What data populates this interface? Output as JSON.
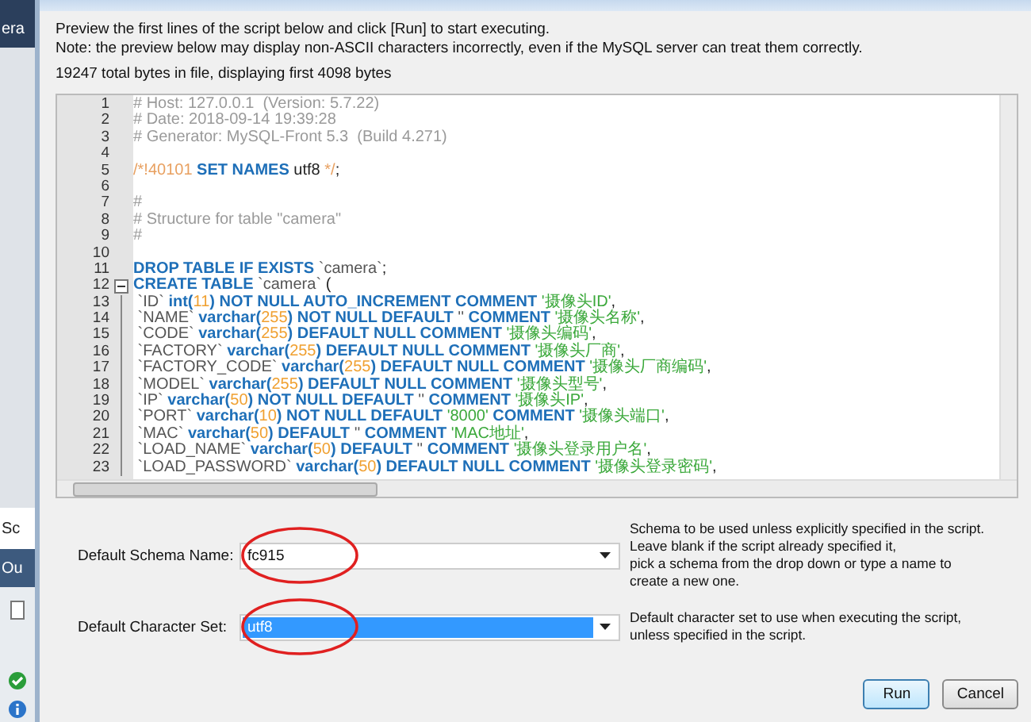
{
  "background_app": {
    "texts": [
      "era",
      "Sc",
      "Ou"
    ]
  },
  "dialog": {
    "intro": [
      "Preview the first lines of the script below and click [Run] to start executing.",
      "Note: the preview below may display non-ASCII characters incorrectly, even if the MySQL server can treat them correctly."
    ],
    "file_info": "19247 total bytes in file, displaying first 4098 bytes",
    "editor": {
      "lines": [
        {
          "number": "1",
          "fold_start": false,
          "in_block": false,
          "segments": [
            {
              "kind": "comment",
              "text": "# Host: 127.0.0.1  (Version: 5.7.22)"
            }
          ]
        },
        {
          "number": "2",
          "fold_start": false,
          "in_block": false,
          "segments": [
            {
              "kind": "comment",
              "text": "# Date: 2018-09-14 19:39:28"
            }
          ]
        },
        {
          "number": "3",
          "fold_start": false,
          "in_block": false,
          "segments": [
            {
              "kind": "comment",
              "text": "# Generator: MySQL-Front 5.3  (Build 4.271)"
            }
          ]
        },
        {
          "number": "4",
          "fold_start": false,
          "in_block": false
        },
        {
          "number": "5",
          "fold_start": false,
          "in_block": false,
          "segments": [
            {
              "kind": "directive",
              "text": "/*!40101 "
            },
            {
              "kind": "keyword",
              "text": "SET NAMES"
            },
            {
              "kind": "plain",
              "text": " utf8 "
            },
            {
              "kind": "directive",
              "text": "*/"
            },
            {
              "kind": "plain",
              "text": ";"
            }
          ]
        },
        {
          "number": "6",
          "fold_start": false,
          "in_block": false
        },
        {
          "number": "7",
          "fold_start": false,
          "in_block": false,
          "segments": [
            {
              "kind": "comment",
              "text": "#"
            }
          ]
        },
        {
          "number": "8",
          "fold_start": false,
          "in_block": false,
          "segments": [
            {
              "kind": "comment",
              "text": "# Structure for table \"camera\""
            }
          ]
        },
        {
          "number": "9",
          "fold_start": false,
          "in_block": false,
          "segments": [
            {
              "kind": "comment",
              "text": "#"
            }
          ]
        },
        {
          "number": "10",
          "fold_start": false,
          "in_block": false
        },
        {
          "number": "11",
          "fold_start": false,
          "in_block": false,
          "segments": [
            {
              "kind": "keyword",
              "text": "DROP TABLE IF EXISTS"
            },
            {
              "kind": "ident",
              "text": " `camera`"
            },
            {
              "kind": "plain",
              "text": ";"
            }
          ]
        },
        {
          "number": "12",
          "fold_start": true,
          "in_block": false,
          "segments": [
            {
              "kind": "keyword",
              "text": "CREATE TABLE"
            },
            {
              "kind": "ident",
              "text": " `camera`"
            },
            {
              "kind": "plain",
              "text": " ("
            }
          ]
        },
        {
          "number": "13",
          "fold_start": false,
          "in_block": true,
          "segments": [
            {
              "kind": "ident",
              "text": " `ID` "
            },
            {
              "kind": "keyword",
              "text": "int("
            },
            {
              "kind": "number",
              "text": "11"
            },
            {
              "kind": "keyword",
              "text": ") NOT NULL AUTO_INCREMENT COMMENT "
            },
            {
              "kind": "string",
              "text": "'摄像头ID'"
            },
            {
              "kind": "plain",
              "text": ","
            }
          ]
        },
        {
          "number": "14",
          "fold_start": false,
          "in_block": true,
          "segments": [
            {
              "kind": "ident",
              "text": " `NAME` "
            },
            {
              "kind": "keyword",
              "text": "varchar("
            },
            {
              "kind": "number",
              "text": "255"
            },
            {
              "kind": "keyword",
              "text": ") NOT NULL DEFAULT "
            },
            {
              "kind": "ident",
              "text": "''"
            },
            {
              "kind": "keyword",
              "text": " COMMENT "
            },
            {
              "kind": "string",
              "text": "'摄像头名称'"
            },
            {
              "kind": "plain",
              "text": ","
            }
          ]
        },
        {
          "number": "15",
          "fold_start": false,
          "in_block": true,
          "segments": [
            {
              "kind": "ident",
              "text": " `CODE` "
            },
            {
              "kind": "keyword",
              "text": "varchar("
            },
            {
              "kind": "number",
              "text": "255"
            },
            {
              "kind": "keyword",
              "text": ") DEFAULT NULL COMMENT "
            },
            {
              "kind": "string",
              "text": "'摄像头编码'"
            },
            {
              "kind": "plain",
              "text": ","
            }
          ]
        },
        {
          "number": "16",
          "fold_start": false,
          "in_block": true,
          "segments": [
            {
              "kind": "ident",
              "text": " `FACTORY` "
            },
            {
              "kind": "keyword",
              "text": "varchar("
            },
            {
              "kind": "number",
              "text": "255"
            },
            {
              "kind": "keyword",
              "text": ") DEFAULT NULL COMMENT "
            },
            {
              "kind": "string",
              "text": "'摄像头厂商'"
            },
            {
              "kind": "plain",
              "text": ","
            }
          ]
        },
        {
          "number": "17",
          "fold_start": false,
          "in_block": true,
          "segments": [
            {
              "kind": "ident",
              "text": " `FACTORY_CODE` "
            },
            {
              "kind": "keyword",
              "text": "varchar("
            },
            {
              "kind": "number",
              "text": "255"
            },
            {
              "kind": "keyword",
              "text": ") DEFAULT NULL COMMENT "
            },
            {
              "kind": "string",
              "text": "'摄像头厂商编码'"
            },
            {
              "kind": "plain",
              "text": ","
            }
          ]
        },
        {
          "number": "18",
          "fold_start": false,
          "in_block": true,
          "segments": [
            {
              "kind": "ident",
              "text": " `MODEL` "
            },
            {
              "kind": "keyword",
              "text": "varchar("
            },
            {
              "kind": "number",
              "text": "255"
            },
            {
              "kind": "keyword",
              "text": ") DEFAULT NULL COMMENT "
            },
            {
              "kind": "string",
              "text": "'摄像头型号'"
            },
            {
              "kind": "plain",
              "text": ","
            }
          ]
        },
        {
          "number": "19",
          "fold_start": false,
          "in_block": true,
          "segments": [
            {
              "kind": "ident",
              "text": " `IP` "
            },
            {
              "kind": "keyword",
              "text": "varchar("
            },
            {
              "kind": "number",
              "text": "50"
            },
            {
              "kind": "keyword",
              "text": ") NOT NULL DEFAULT "
            },
            {
              "kind": "ident",
              "text": "''"
            },
            {
              "kind": "keyword",
              "text": " COMMENT "
            },
            {
              "kind": "string",
              "text": "'摄像头IP'"
            },
            {
              "kind": "plain",
              "text": ","
            }
          ]
        },
        {
          "number": "20",
          "fold_start": false,
          "in_block": true,
          "segments": [
            {
              "kind": "ident",
              "text": " `PORT` "
            },
            {
              "kind": "keyword",
              "text": "varchar("
            },
            {
              "kind": "number",
              "text": "10"
            },
            {
              "kind": "keyword",
              "text": ") NOT NULL DEFAULT "
            },
            {
              "kind": "string",
              "text": "'8000'"
            },
            {
              "kind": "keyword",
              "text": " COMMENT "
            },
            {
              "kind": "string",
              "text": "'摄像头端口'"
            },
            {
              "kind": "plain",
              "text": ","
            }
          ]
        },
        {
          "number": "21",
          "fold_start": false,
          "in_block": true,
          "segments": [
            {
              "kind": "ident",
              "text": " `MAC` "
            },
            {
              "kind": "keyword",
              "text": "varchar("
            },
            {
              "kind": "number",
              "text": "50"
            },
            {
              "kind": "keyword",
              "text": ") DEFAULT "
            },
            {
              "kind": "ident",
              "text": "''"
            },
            {
              "kind": "keyword",
              "text": " COMMENT "
            },
            {
              "kind": "string",
              "text": "'MAC地址'"
            },
            {
              "kind": "plain",
              "text": ","
            }
          ]
        },
        {
          "number": "22",
          "fold_start": false,
          "in_block": true,
          "segments": [
            {
              "kind": "ident",
              "text": " `LOAD_NAME` "
            },
            {
              "kind": "keyword",
              "text": "varchar("
            },
            {
              "kind": "number",
              "text": "50"
            },
            {
              "kind": "keyword",
              "text": ") DEFAULT "
            },
            {
              "kind": "ident",
              "text": "''"
            },
            {
              "kind": "keyword",
              "text": " COMMENT "
            },
            {
              "kind": "string",
              "text": "'摄像头登录用户名'"
            },
            {
              "kind": "plain",
              "text": ","
            }
          ]
        },
        {
          "number": "23",
          "fold_start": false,
          "in_block": true,
          "segments": [
            {
              "kind": "ident",
              "text": " `LOAD_PASSWORD` "
            },
            {
              "kind": "keyword",
              "text": "varchar("
            },
            {
              "kind": "number",
              "text": "50"
            },
            {
              "kind": "keyword",
              "text": ") DEFAULT NULL COMMENT "
            },
            {
              "kind": "string",
              "text": "'摄像头登录密码'"
            },
            {
              "kind": "plain",
              "text": ","
            }
          ]
        }
      ]
    },
    "fields": [
      {
        "label": "Default Schema Name:",
        "value": "fc915",
        "selected": false,
        "circled": true,
        "help": [
          "Schema to be used unless explicitly specified in the script.",
          "Leave blank if the script already specified it,",
          "pick a schema from the drop down or type a name to",
          "create a new one."
        ]
      },
      {
        "label": "Default Character Set:",
        "value": "utf8",
        "selected": true,
        "circled": true,
        "help": [
          "Default character set to use when executing the script,",
          "unless specified in the script."
        ]
      }
    ],
    "buttons": [
      {
        "label": "Run",
        "default": true
      },
      {
        "label": "Cancel",
        "default": false
      }
    ]
  }
}
